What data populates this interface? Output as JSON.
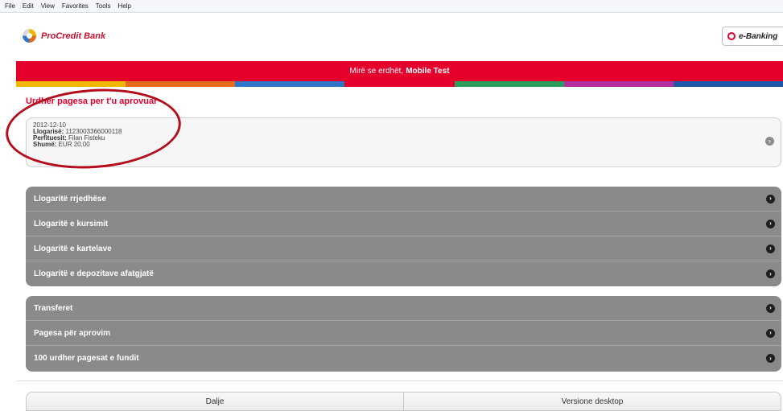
{
  "menubar": {
    "items": [
      "File",
      "Edit",
      "View",
      "Favorites",
      "Tools",
      "Help"
    ]
  },
  "header": {
    "brand": "ProCredit Bank",
    "ebanking_label": "e-Banking"
  },
  "welcome": {
    "greeting": "Mirë se erdhët,",
    "user": "Mobile Test"
  },
  "stripe_colors": [
    "#f2b705",
    "#e36b1c",
    "#2f75c6",
    "#e4002b",
    "#2a9d5c",
    "#b22fa0",
    "#1f58a8"
  ],
  "pending": {
    "title": "Urdher pagesa per t'u aprovuar",
    "date": "2012-12-10",
    "account_label": "Llogarisë:",
    "account_value": "1123003366000118",
    "beneficiary_label": "Perfituesit:",
    "beneficiary_value": "Filan Fisteku",
    "amount_label": "Shumë:",
    "amount_value": "EUR 20,00"
  },
  "accounts_menu": [
    {
      "label": "Llogaritë rrjedhëse"
    },
    {
      "label": "Llogaritë e kursimit"
    },
    {
      "label": "Llogaritë e kartelave"
    },
    {
      "label": "Llogaritë e depozitave afatgjatë"
    }
  ],
  "transfers_menu": [
    {
      "label": "Transferet"
    },
    {
      "label": "Pagesa për aprovim"
    },
    {
      "label": "100 urdher pagesat e fundit"
    }
  ],
  "footer": {
    "logout_label": "Dalje",
    "desktop_label": "Versione desktop"
  },
  "colors": {
    "brand_red": "#e4002b",
    "menu_gray": "#8a8a8a",
    "annotation": "#b40d1c"
  },
  "icons": {
    "chevron": "›"
  }
}
